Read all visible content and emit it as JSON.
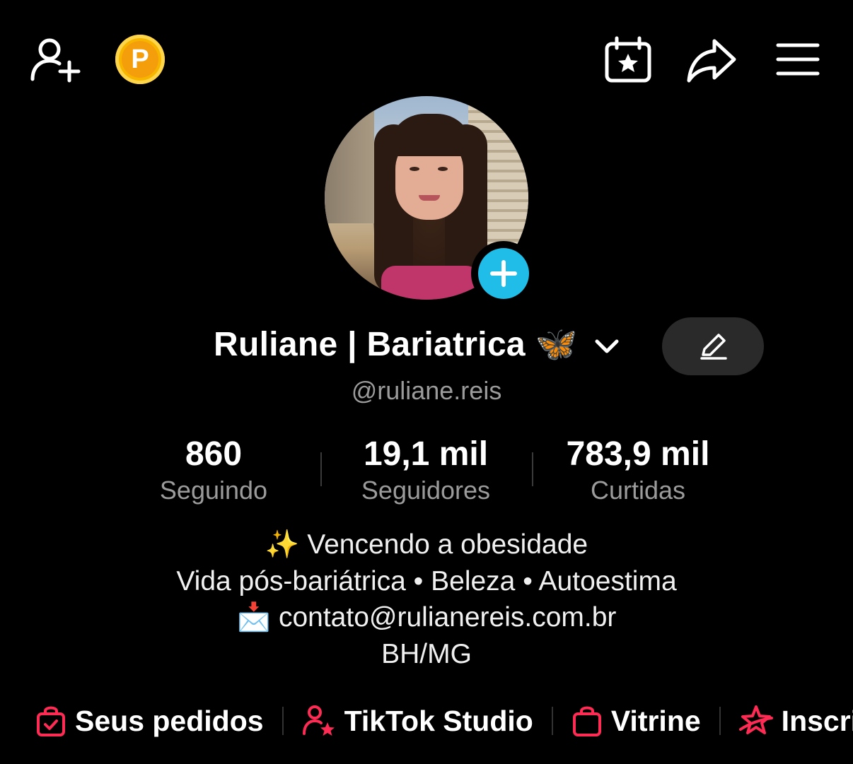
{
  "topbar": {
    "add_friend_icon": "person-plus-icon",
    "coin_letter": "P",
    "calendar_icon": "calendar-star-icon",
    "share_icon": "share-arrow-icon",
    "menu_icon": "hamburger-menu-icon"
  },
  "profile": {
    "display_name": "Ruliane | Bariatrica 🦋",
    "handle": "@ruliane.reis"
  },
  "stats": [
    {
      "value": "860",
      "label": "Seguindo"
    },
    {
      "value": "19,1 mil",
      "label": "Seguidores"
    },
    {
      "value": "783,9 mil",
      "label": "Curtidas"
    }
  ],
  "bio": {
    "line1": "✨ Vencendo a obesidade",
    "line2": "Vida pós-bariátrica • Beleza • Autoestima",
    "line3": "📩 contato@rulianereis.com.br",
    "line4": "BH/MG"
  },
  "links": [
    {
      "label": "Seus pedidos",
      "icon": "shopping-bag-check-icon"
    },
    {
      "label": "TikTok Studio",
      "icon": "person-star-icon"
    },
    {
      "label": "Vitrine",
      "icon": "shopping-bag-icon"
    },
    {
      "label": "Inscri",
      "icon": "star-ribbon-icon"
    }
  ],
  "colors": {
    "accent_pink": "#fe2c55",
    "plus_blue": "#20bde8",
    "coin_gold": "#f7b500"
  }
}
